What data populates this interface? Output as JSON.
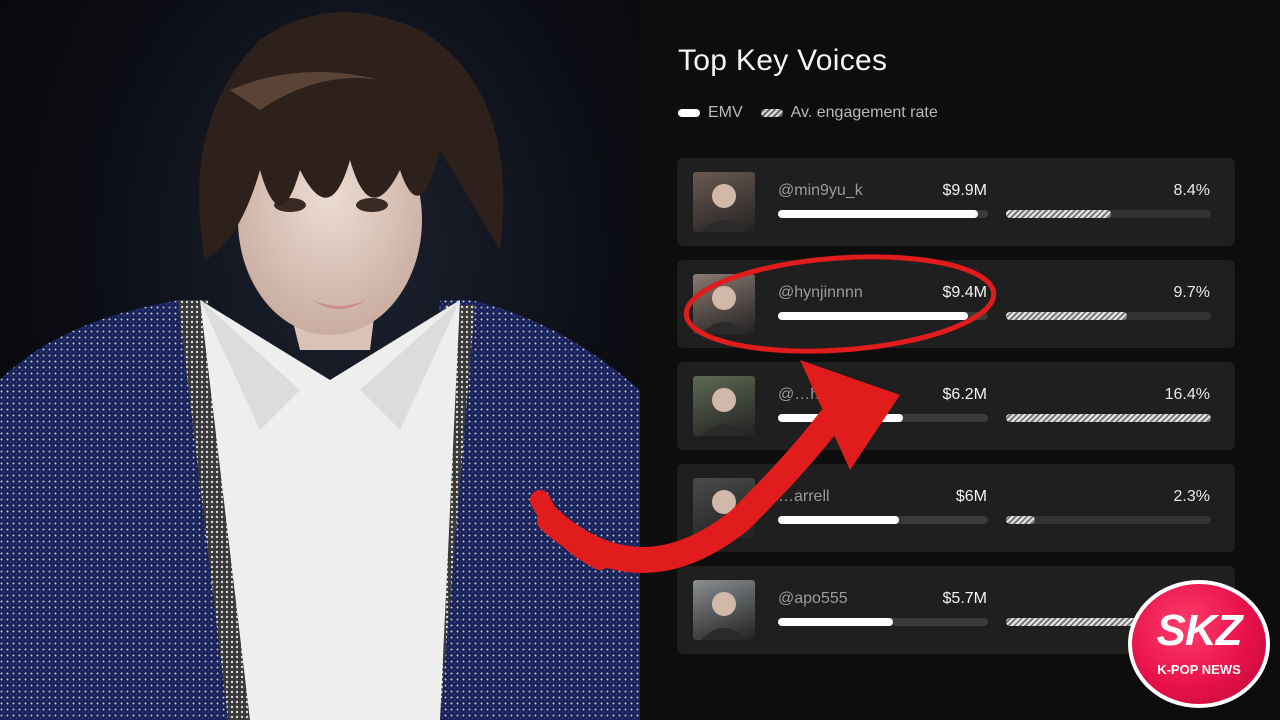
{
  "chart_data": {
    "type": "bar",
    "title": "Top Key Voices",
    "legend": [
      "EMV",
      "Av. engagement rate"
    ],
    "series": [
      {
        "name": "EMV",
        "unit": "$M",
        "values": [
          9.9,
          9.4,
          6.2,
          6.0,
          5.7
        ]
      },
      {
        "name": "Av. engagement rate",
        "unit": "%",
        "values": [
          8.4,
          9.7,
          16.4,
          2.3,
          null
        ]
      }
    ],
    "rows": [
      {
        "handle": "@min9yu_k",
        "emv_label": "$9.9M",
        "emv": 9.9,
        "rate_label": "8.4%",
        "rate": 8.4
      },
      {
        "handle": "@hynjinnnn",
        "emv_label": "$9.4M",
        "emv": 9.4,
        "rate_label": "9.7%",
        "rate": 9.7
      },
      {
        "handle": "@…h.ig",
        "emv_label": "$6.2M",
        "emv": 6.2,
        "rate_label": "16.4%",
        "rate": 16.4
      },
      {
        "handle": "…arrell",
        "emv_label": "$6M",
        "emv": 6.0,
        "rate_label": "2.3%",
        "rate": 2.3
      },
      {
        "handle": "@apo555",
        "emv_label": "$5.7M",
        "emv": 5.7,
        "rate_label": "",
        "rate": null
      }
    ],
    "emv_max": 10.4,
    "rate_max": 16.4
  },
  "colors": {
    "background": "#0d0d0d",
    "row_bg": "#1f1f1f",
    "emv_bar": "#ffffff",
    "annotation_red": "#e01c1c",
    "logo_red": "#e8114a"
  },
  "logo": {
    "main": "SKZ",
    "sub": "K-POP NEWS"
  },
  "icons": [
    "annotation-circle",
    "annotation-arrow",
    "photo-portrait"
  ]
}
